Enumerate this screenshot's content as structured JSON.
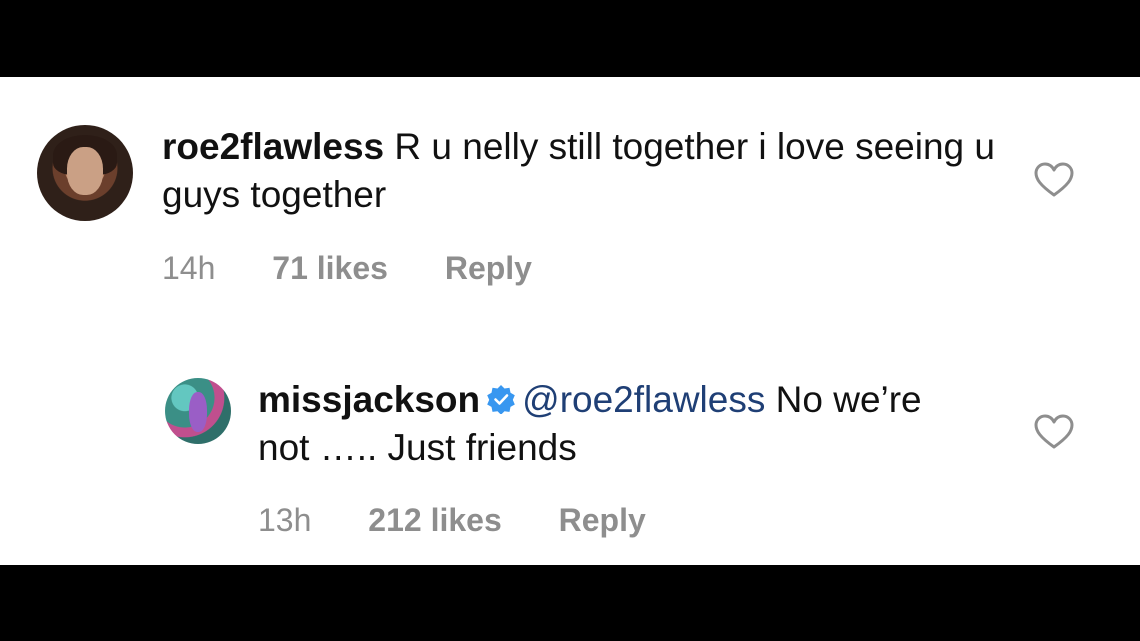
{
  "comments": [
    {
      "username": "roe2flawless",
      "text": "R u nelly still together i love seeing u guys together",
      "time": "14h",
      "likes": "71 likes",
      "reply_label": "Reply"
    },
    {
      "username": "missjackson",
      "verified": true,
      "mention": "@roe2flawless",
      "text": "No we’re not ….. Just friends",
      "time": "13h",
      "likes": "212 likes",
      "reply_label": "Reply"
    }
  ],
  "icons": {
    "like": "heart-icon",
    "verified": "verified-badge-icon"
  },
  "colors": {
    "verified": "#3897f0",
    "meta": "#8e8e8e",
    "mention": "#1f3f75"
  }
}
